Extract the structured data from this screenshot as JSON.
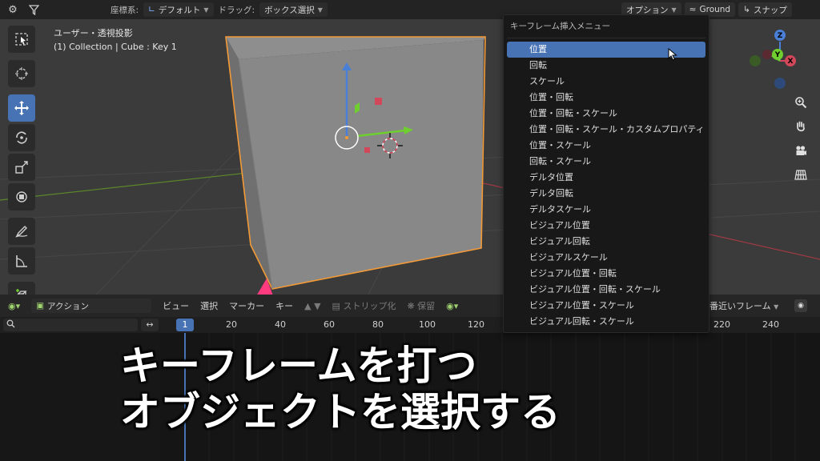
{
  "header": {
    "coord_label": "座標系:",
    "coord_value": "デフォルト",
    "drag_label": "ドラッグ:",
    "drag_value": "ボックス選択",
    "options_label": "オプション",
    "ground_label": "Ground",
    "snap_label": "スナップ"
  },
  "viewport": {
    "view_name": "ユーザー・透視投影",
    "object_info": "(1) Collection | Cube : Key 1",
    "gizmo_axes": [
      "Z",
      "Y",
      "X"
    ]
  },
  "menu": {
    "title": "キーフレーム挿入メニュー",
    "items": [
      "位置",
      "回転",
      "スケール",
      "位置・回転",
      "位置・回転・スケール",
      "位置・回転・スケール・カスタムプロパティ",
      "位置・スケール",
      "回転・スケール",
      "デルタ位置",
      "デルタ回転",
      "デルタスケール",
      "ビジュアル位置",
      "ビジュアル回転",
      "ビジュアルスケール",
      "ビジュアル位置・回転",
      "ビジュアル位置・回転・スケール",
      "ビジュアル位置・スケール",
      "ビジュアル回転・スケール"
    ]
  },
  "timeline": {
    "mode_label": "アクション",
    "view_menu": "ビュー",
    "select_menu": "選択",
    "marker_menu": "マーカー",
    "key_menu": "キー",
    "strip_label": "ストリップ化",
    "keep_label": "保留",
    "nearest_frame_label": "番近いフレーム",
    "current_frame": "1",
    "ticks": [
      "20",
      "40",
      "60",
      "80",
      "100",
      "120",
      "220",
      "240"
    ]
  },
  "caption": {
    "line1": "キーフレームを打つ",
    "line2": "オブジェクトを選択する"
  },
  "colors": {
    "accent": "#4772b3",
    "selection_outline": "#f39a37",
    "arrow": "#ff3b7f"
  }
}
